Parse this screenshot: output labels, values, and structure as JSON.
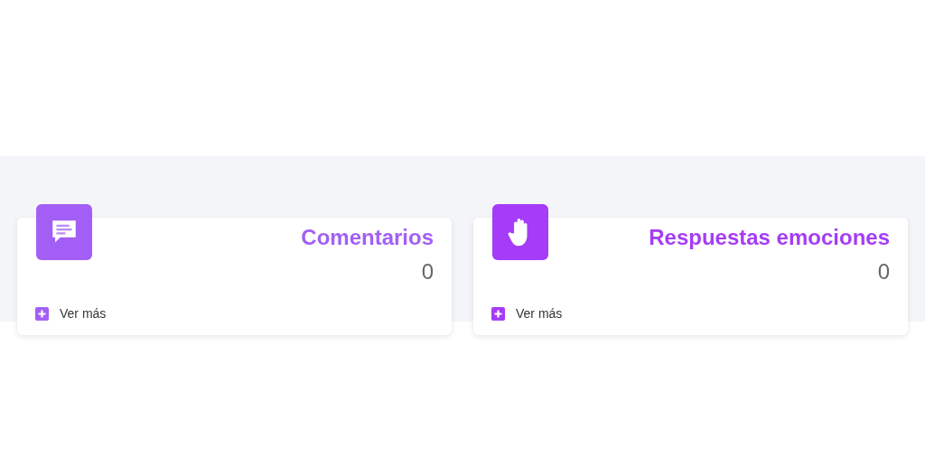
{
  "cards": [
    {
      "kind": "comments",
      "color": "#a35ff5",
      "title": "Comentarios",
      "value": "0",
      "link": "Ver más"
    },
    {
      "kind": "hand",
      "color": "#a53cf7",
      "title": "Respuestas emociones",
      "value": "0",
      "link": "Ver más"
    }
  ]
}
